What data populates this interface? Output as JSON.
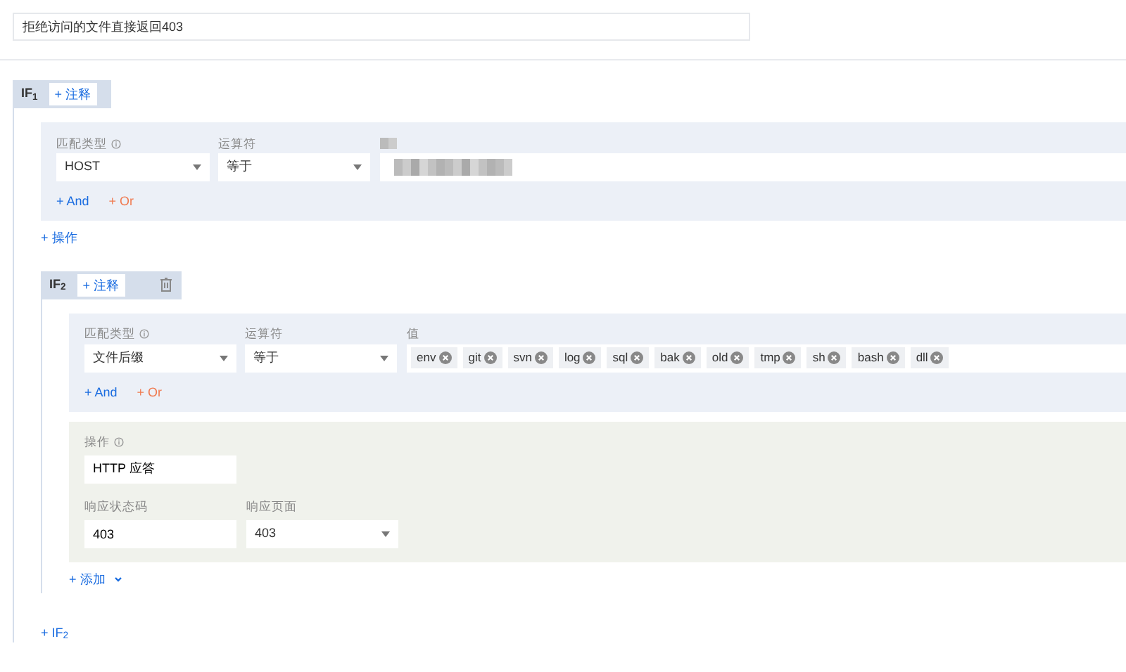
{
  "rule_name": {
    "value": "拒绝访问的文件直接返回403"
  },
  "conditions": [
    {
      "title": "IF$_{1}$",
      "note_button": "+ 注释",
      "deletable": false,
      "match": [
        {
          "match_type_label": "匹配类型",
          "match_type": "HOST",
          "operator_label": "运算符",
          "operator": "等于",
          "value_redacted": true
        }
      ],
      "and_button": "+ And",
      "or_button": "+ Or",
      "action_add": "+ 操作"
    },
    {
      "title": "IF$_{2}$",
      "note_button": "+ 注释",
      "deletable": true,
      "match": [
        {
          "match_type_label": "匹配类型",
          "match_type": "文件后缀",
          "operator_label": "运算符",
          "operator": "等于",
          "value_label": "值",
          "tags": [
            "env",
            "git",
            "svn",
            "log",
            "sql",
            "bak",
            "old",
            "tmp",
            "sh",
            "bash",
            "dll"
          ]
        }
      ],
      "and_button": "+ And",
      "or_button": "+ Or",
      "action": {
        "label": "操作",
        "value": "HTTP 应答",
        "status_label": "响应状态码",
        "status": "403",
        "page_label": "响应页面",
        "page": "403"
      },
      "add_button": "+ 添加"
    }
  ],
  "add_if": "+ IF$_{2}$"
}
